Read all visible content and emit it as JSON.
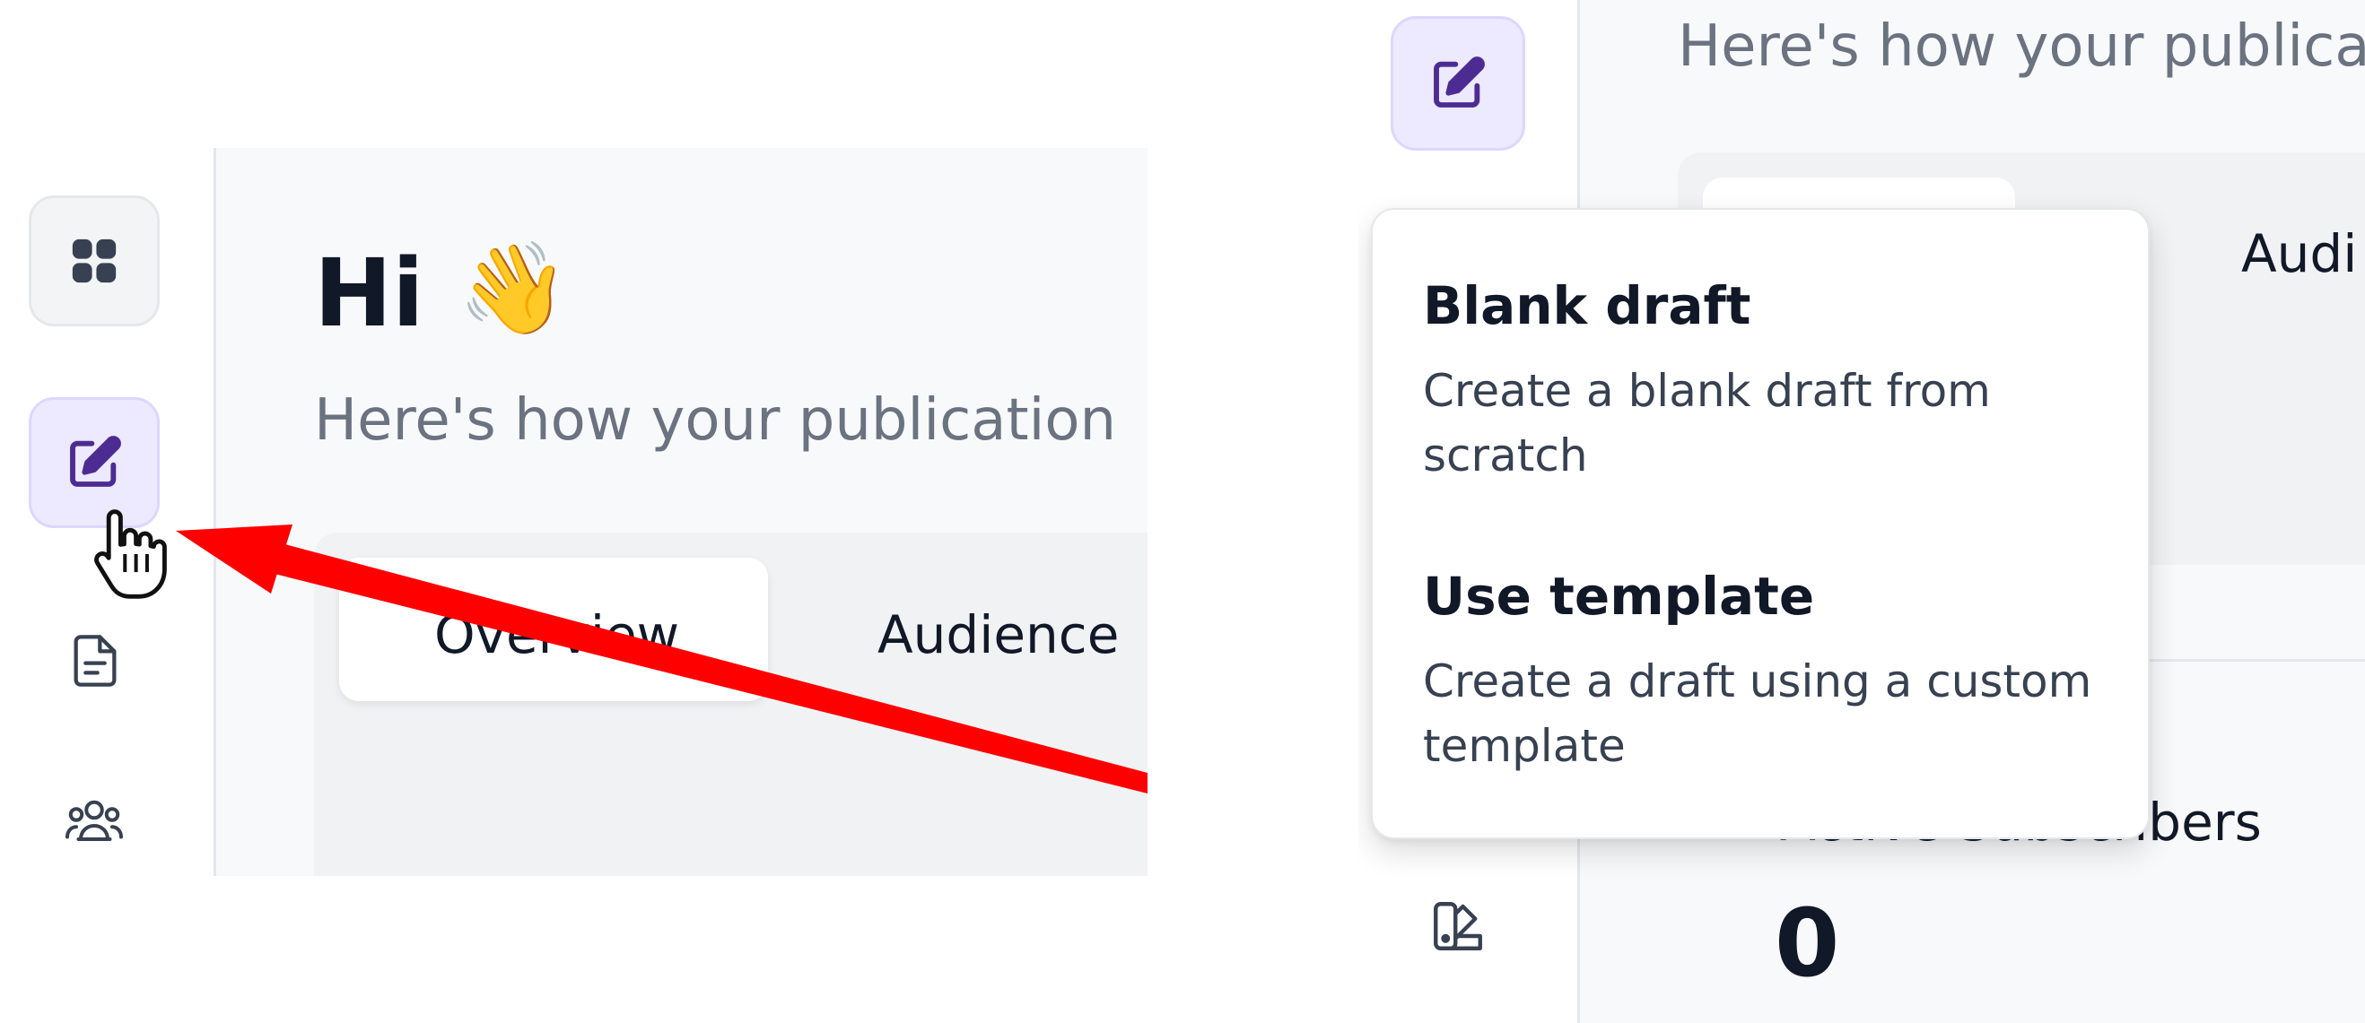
{
  "left_panel": {
    "greeting": "Hi",
    "greeting_emoji": "👋",
    "subtitle": "Here's how your publication",
    "tabs": [
      {
        "label": "Overview",
        "active": true
      },
      {
        "label": "Audience",
        "active": false
      }
    ],
    "sidebar": [
      {
        "icon": "dashboard-grid-icon",
        "active": false
      },
      {
        "icon": "edit-icon",
        "active": true
      },
      {
        "icon": "document-icon",
        "active": false
      },
      {
        "icon": "users-icon",
        "active": false
      }
    ]
  },
  "right_panel": {
    "subtitle": "Here's how your publica",
    "tab_partial": "Audi",
    "sidebar": [
      {
        "icon": "edit-icon",
        "active": true
      },
      {
        "icon": "palette-icon",
        "active": false
      }
    ],
    "dropdown": {
      "items": [
        {
          "title": "Blank draft",
          "description": "Create a blank draft from scratch"
        },
        {
          "title": "Use template",
          "description": "Create a draft using a custom template"
        }
      ]
    },
    "stat": {
      "label": "Active Subscribers",
      "value": "0"
    }
  },
  "colors": {
    "accent_purple": "#4c2c92",
    "active_bg": "#ede9fe",
    "arrow_red": "#ff0000"
  }
}
